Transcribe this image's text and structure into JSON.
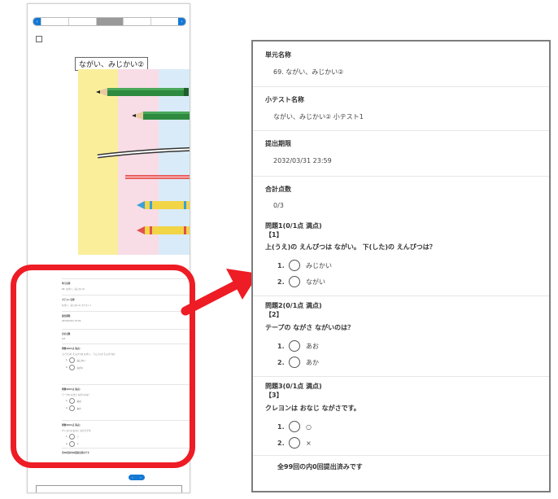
{
  "thumbnail": {
    "tabs": [
      "",
      "",
      "",
      "",
      ""
    ],
    "active_tab": 2,
    "reading_title": "ながい、みじかい②",
    "page_number": "69",
    "picture_colors": [
      "#fbee9a",
      "#f8dce6",
      "#d9ebf8"
    ]
  },
  "panel": {
    "unit_label": "単元名称",
    "unit_value": "69. ながい、みじかい②",
    "test_label": "小テスト名称",
    "test_value": "ながい、みじかい②  小テスト1",
    "deadline_label": "提出期限",
    "deadline_value": "2032/03/31 23:59",
    "score_label": "合計点数",
    "score_value": "0/3",
    "questions": [
      {
        "heading": "問題1(0/1点 満点)",
        "number": "【1】",
        "text": "上(うえ)の  えんぴつは  ながい。   下(した)の  えんぴつは？",
        "options": [
          {
            "num": "1.",
            "label": "みじかい"
          },
          {
            "num": "2.",
            "label": "ながい"
          }
        ]
      },
      {
        "heading": "問題2(0/1点 満点)",
        "number": "【2】",
        "text": "テープの  ながさ  ながいのは？",
        "options": [
          {
            "num": "1.",
            "label": "あお"
          },
          {
            "num": "2.",
            "label": "あか"
          }
        ]
      },
      {
        "heading": "問題3(0/1点 満点)",
        "number": "【3】",
        "text": "クレヨンは  おなじ  ながさです。",
        "options": [
          {
            "num": "1.",
            "label": "○"
          },
          {
            "num": "2.",
            "label": "×"
          }
        ]
      }
    ],
    "footer_note": "全99回の内0回提出済みです"
  },
  "colors": {
    "accent_blue": "#1478d4",
    "highlight_red": "#ee1c24",
    "panel_border": "#7d7d7d"
  }
}
